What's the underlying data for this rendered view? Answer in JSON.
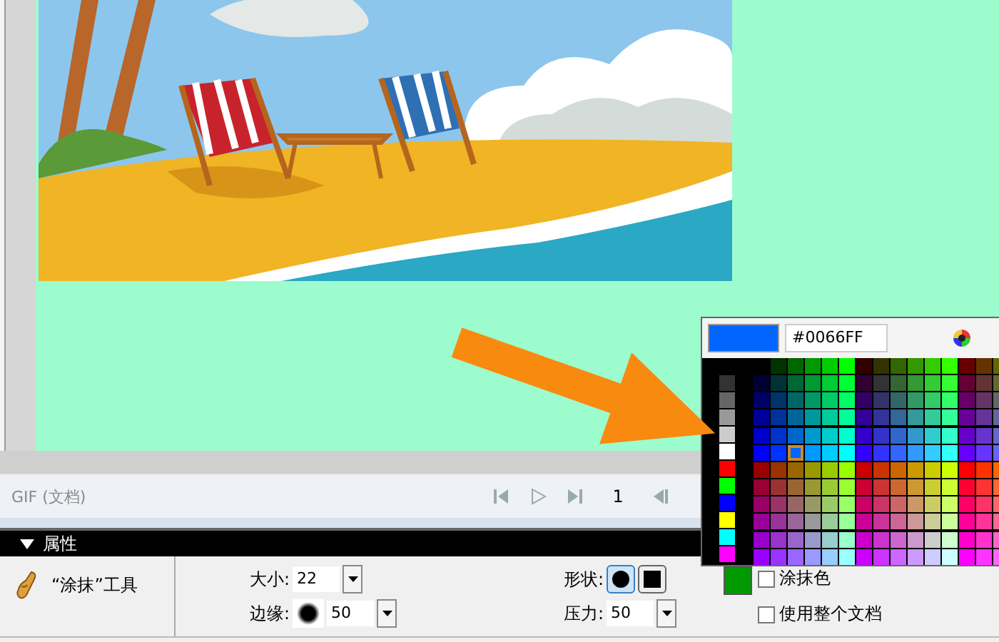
{
  "status_bar": {
    "document_label": "GIF (文档)",
    "frame": "1"
  },
  "properties_panel": {
    "title": "属性",
    "expanded": true,
    "tool_name": "“涂抹”工具",
    "size": {
      "label": "大小:",
      "value": "22"
    },
    "edge": {
      "label": "边缘:",
      "value": "50"
    },
    "shape": {
      "label": "形状:",
      "options": [
        {
          "kind": "circle",
          "selected": true
        },
        {
          "kind": "square",
          "selected": false
        }
      ]
    },
    "pressure": {
      "label": "压力:",
      "value": "50"
    },
    "color_well": {
      "color": "#009900"
    },
    "checkboxes": [
      {
        "label": "涂抹色",
        "checked": false
      },
      {
        "label": "使用整个文档",
        "checked": false
      }
    ]
  },
  "color_picker": {
    "color": "#0066ff",
    "hex": "#0066FF"
  }
}
